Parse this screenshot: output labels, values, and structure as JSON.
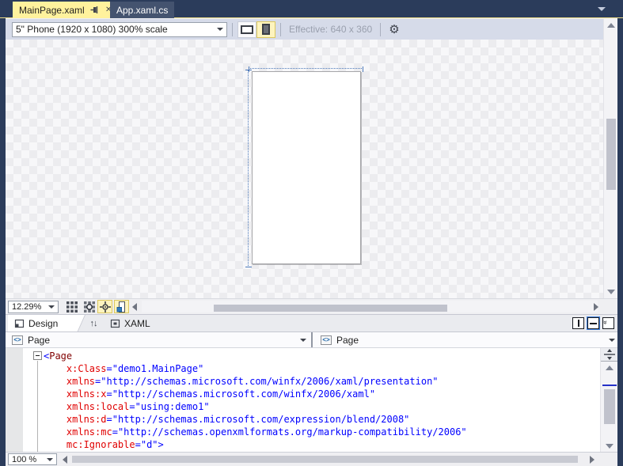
{
  "tabs": [
    {
      "label": "MainPage.xaml",
      "active": true
    },
    {
      "label": "App.xaml.cs",
      "active": false
    }
  ],
  "toolbar": {
    "device_selector": "5\" Phone (1920 x 1080) 300% scale",
    "effective_label": "Effective: 640 x 360"
  },
  "designer": {
    "zoom_value": "12.29%"
  },
  "pane_tabs": {
    "design_label": "Design",
    "xaml_label": "XAML"
  },
  "breadcrumb": {
    "left_value": "Page",
    "right_value": "Page"
  },
  "editor": {
    "zoom_value": "100 %",
    "lines": [
      [
        [
          "delim",
          "<"
        ],
        [
          "elem",
          "Page"
        ]
      ],
      [
        [
          "plain",
          "    "
        ],
        [
          "attr",
          "x:Class"
        ],
        [
          "delim",
          "="
        ],
        [
          "val",
          "\"demo1.MainPage\""
        ]
      ],
      [
        [
          "plain",
          "    "
        ],
        [
          "attr",
          "xmlns"
        ],
        [
          "delim",
          "="
        ],
        [
          "val",
          "\"http://schemas.microsoft.com/winfx/2006/xaml/presentation\""
        ]
      ],
      [
        [
          "plain",
          "    "
        ],
        [
          "attr",
          "xmlns:x"
        ],
        [
          "delim",
          "="
        ],
        [
          "val",
          "\"http://schemas.microsoft.com/winfx/2006/xaml\""
        ]
      ],
      [
        [
          "plain",
          "    "
        ],
        [
          "attr",
          "xmlns:local"
        ],
        [
          "delim",
          "="
        ],
        [
          "val",
          "\"using:demo1\""
        ]
      ],
      [
        [
          "plain",
          "    "
        ],
        [
          "attr",
          "xmlns:d"
        ],
        [
          "delim",
          "="
        ],
        [
          "val",
          "\"http://schemas.microsoft.com/expression/blend/2008\""
        ]
      ],
      [
        [
          "plain",
          "    "
        ],
        [
          "attr",
          "xmlns:mc"
        ],
        [
          "delim",
          "="
        ],
        [
          "val",
          "\"http://schemas.openxmlformats.org/markup-compatibility/2006\""
        ]
      ],
      [
        [
          "plain",
          "    "
        ],
        [
          "attr",
          "mc:Ignorable"
        ],
        [
          "delim",
          "="
        ],
        [
          "val",
          "\"d\""
        ],
        [
          "delim",
          ">"
        ]
      ]
    ]
  },
  "icons": {
    "close": "✕",
    "gear": "⚙",
    "swap": "↑↓",
    "element": "<>",
    "chevrons": "»"
  },
  "colors": {
    "navy": "#2B3C5B",
    "active_tab": "#FFF29D",
    "toolbar_bg": "#D6DBE9",
    "highlight_btn": "#FDF4BF",
    "code_delimiter": "#0000FF",
    "code_element": "#800000",
    "code_attribute": "#E00000",
    "code_value": "#0000FF"
  }
}
